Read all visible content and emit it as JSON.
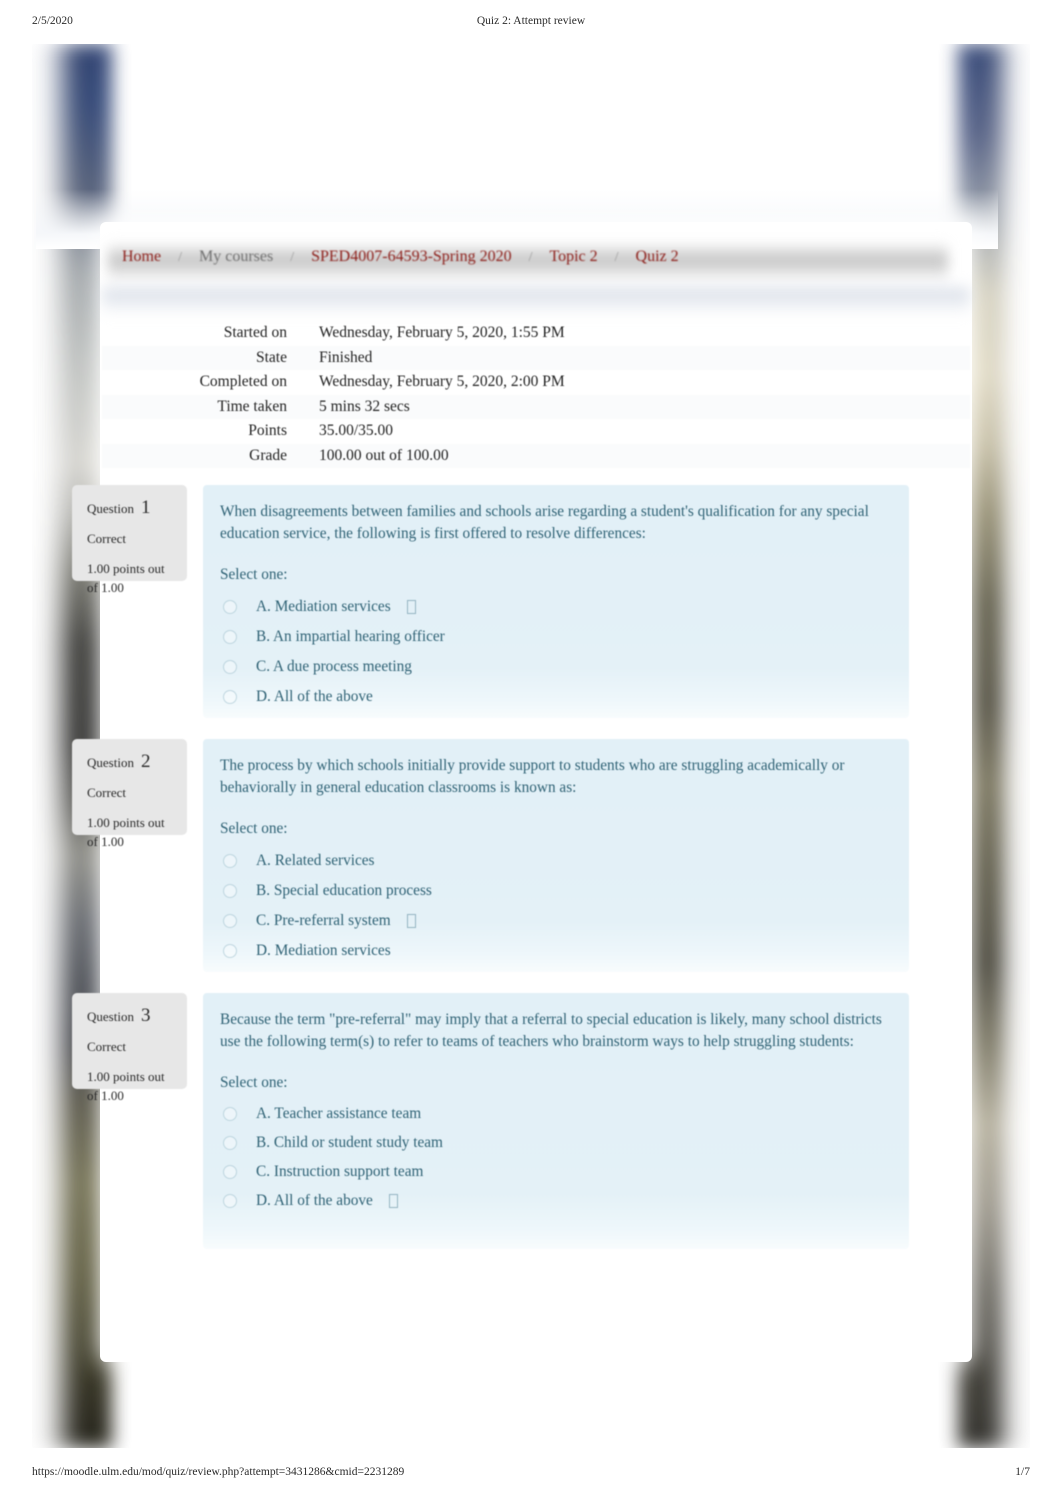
{
  "print": {
    "date": "2/5/2020",
    "doc_title": "Quiz 2: Attempt review",
    "url": "https://moodle.ulm.edu/mod/quiz/review.php?attempt=3431286&cmid=2231289",
    "page_number": "1/7"
  },
  "colors": {
    "link": "#8b1a15",
    "muted": "#6d6d6d",
    "question_bg": "#e2f0f7",
    "info_bg": "#e7e7e7",
    "question_text": "#2f6275"
  },
  "breadcrumb": {
    "separator": "/",
    "items": [
      {
        "label": "Home",
        "muted": false
      },
      {
        "label": "My courses",
        "muted": true
      },
      {
        "label": "SPED4007-64593-Spring 2020",
        "muted": false
      },
      {
        "label": "Topic 2",
        "muted": false
      },
      {
        "label": "Quiz 2",
        "muted": false
      }
    ]
  },
  "summary": {
    "rows": [
      {
        "label": "Started on",
        "value": "Wednesday, February 5, 2020, 1:55 PM"
      },
      {
        "label": "State",
        "value": "Finished"
      },
      {
        "label": "Completed on",
        "value": "Wednesday, February 5, 2020, 2:00 PM"
      },
      {
        "label": "Time taken",
        "value": "5 mins 32 secs"
      },
      {
        "label": "Points",
        "value": "35.00/35.00"
      },
      {
        "label": "Grade",
        "value": "100.00   out of 100.00"
      }
    ]
  },
  "questions": [
    {
      "number_label": "Question",
      "number": "1",
      "state": "Correct",
      "mark": "1.00 points out of 1.00",
      "text": "When disagreements between families and schools arise regarding a student's qualification for any special education service, the following is first offered to resolve differences:",
      "select_label": "Select one:",
      "answers": [
        {
          "label": "A. Mediation services",
          "selected": true
        },
        {
          "label": "B. An impartial hearing officer",
          "selected": false
        },
        {
          "label": "C. A due process meeting",
          "selected": false
        },
        {
          "label": "D. All of the above",
          "selected": false
        }
      ]
    },
    {
      "number_label": "Question",
      "number": "2",
      "state": "Correct",
      "mark": "1.00 points out of 1.00",
      "text": "The process by which schools initially provide support to students who are struggling academically or behaviorally in general education classrooms is known as:",
      "select_label": "Select one:",
      "answers": [
        {
          "label": "A. Related services",
          "selected": false
        },
        {
          "label": "B. Special education process",
          "selected": false
        },
        {
          "label": "C. Pre-referral system",
          "selected": true
        },
        {
          "label": "D. Mediation services",
          "selected": false
        }
      ]
    },
    {
      "number_label": "Question",
      "number": "3",
      "state": "Correct",
      "mark": "1.00 points out of 1.00",
      "text": "Because the term \"pre-referral\" may imply that a referral to special education is likely, many school districts use the following term(s) to refer to teams of teachers who brainstorm ways to help struggling students:",
      "select_label": "Select one:",
      "answers": [
        {
          "label": "A. Teacher assistance team",
          "selected": false
        },
        {
          "label": "B. Child or student study team",
          "selected": false
        },
        {
          "label": "C. Instruction support team",
          "selected": false
        },
        {
          "label": "D. All of the above",
          "selected": true
        }
      ]
    }
  ]
}
